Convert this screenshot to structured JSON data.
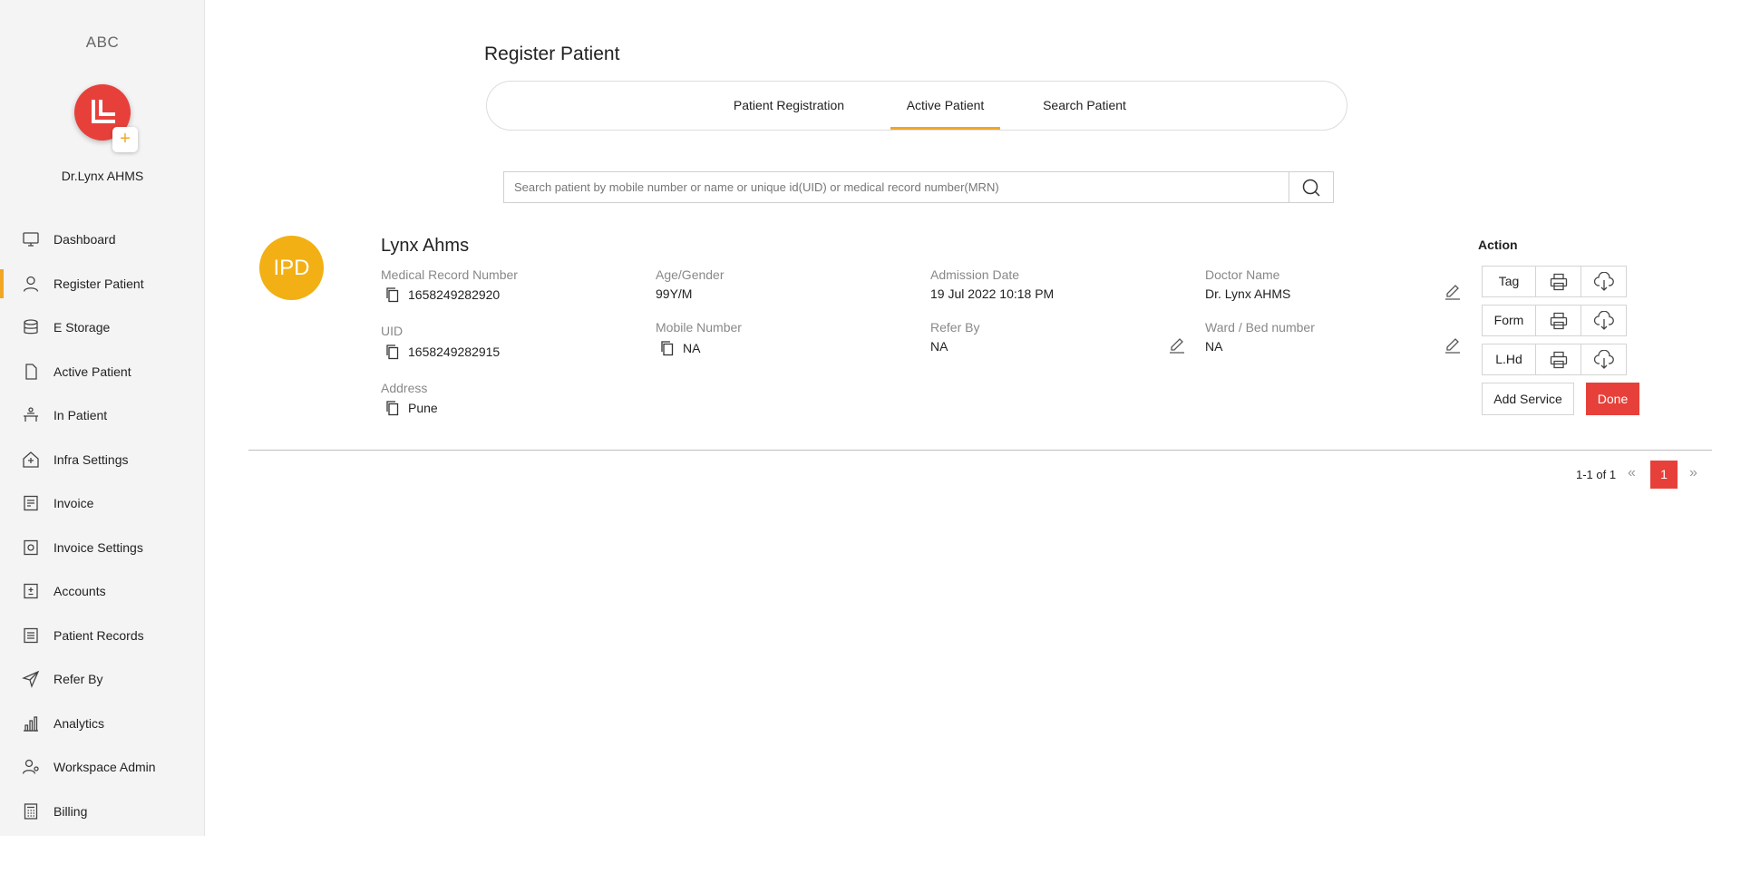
{
  "sidebar": {
    "brand": "ABC",
    "doctor_name": "Dr.Lynx AHMS",
    "add_symbol": "+",
    "items": [
      {
        "label": "Dashboard",
        "icon": "monitor-icon"
      },
      {
        "label": "Register Patient",
        "icon": "user-icon",
        "active": true
      },
      {
        "label": "E Storage",
        "icon": "database-icon"
      },
      {
        "label": "Active Patient",
        "icon": "file-icon"
      },
      {
        "label": "In Patient",
        "icon": "bed-icon"
      },
      {
        "label": "Infra Settings",
        "icon": "building-icon"
      },
      {
        "label": "Invoice",
        "icon": "invoice-icon"
      },
      {
        "label": "Invoice Settings",
        "icon": "invoice-settings-icon"
      },
      {
        "label": "Accounts",
        "icon": "accounts-icon"
      },
      {
        "label": "Patient Records",
        "icon": "records-icon"
      },
      {
        "label": "Refer By",
        "icon": "send-icon"
      },
      {
        "label": "Analytics",
        "icon": "bar-chart-icon"
      },
      {
        "label": "Workspace Admin",
        "icon": "admin-user-icon"
      },
      {
        "label": "Billing",
        "icon": "calculator-icon"
      }
    ]
  },
  "main": {
    "page_title": "Register Patient",
    "tabs": [
      {
        "label": "Patient Registration"
      },
      {
        "label": "Active Patient",
        "active": true
      },
      {
        "label": "Search Patient"
      }
    ],
    "search": {
      "placeholder": "Search patient by mobile number or name or unique id(UID) or medical record number(MRN)",
      "value": ""
    }
  },
  "patient": {
    "badge": "IPD",
    "name": "Lynx Ahms",
    "fields": {
      "mrn_label": "Medical Record Number",
      "mrn_value": "1658249282920",
      "uid_label": "UID",
      "uid_value": "1658249282915",
      "address_label": "Address",
      "address_value": "Pune",
      "age_gender_label": "Age/Gender",
      "age_gender_value": "99Y/M",
      "mobile_label": "Mobile Number",
      "mobile_value": "NA",
      "admission_label": "Admission Date",
      "admission_value": "19 Jul 2022 10:18 PM",
      "refer_label": "Refer By",
      "refer_value": "NA",
      "doctor_label": "Doctor Name",
      "doctor_value": "Dr. Lynx AHMS",
      "ward_label": "Ward / Bed number",
      "ward_value": "NA"
    }
  },
  "actions": {
    "title": "Action",
    "rows": [
      {
        "label": "Tag"
      },
      {
        "label": "Form"
      },
      {
        "label": "L.Hd"
      }
    ],
    "add_service": "Add Service",
    "done": "Done"
  },
  "pagination": {
    "info": "1-1 of 1",
    "prev": "«",
    "page": "1",
    "next": "»"
  },
  "colors": {
    "accent": "#f2a724",
    "primary_red": "#e7403a",
    "ipd_badge": "#f2b015"
  }
}
